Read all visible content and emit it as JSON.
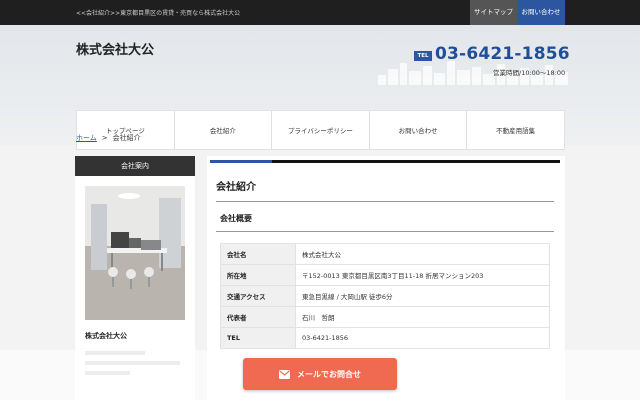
{
  "topbar": {
    "tagline": "<<会社紹介>>東京都目黒区の賃貸・売買なら株式会社大公",
    "sitemap_label": "サイトマップ",
    "contact_label": "お問い合わせ"
  },
  "header": {
    "logo": "株式会社大公",
    "tel_badge": "TEL",
    "tel": "03-6421-1856",
    "hours": "営業時間/10:00～18:00"
  },
  "nav": {
    "items": [
      {
        "label": "トップページ"
      },
      {
        "label": "会社紹介"
      },
      {
        "label": "プライバシーポリシー"
      },
      {
        "label": "お問い合わせ"
      },
      {
        "label": "不動産用語集"
      }
    ]
  },
  "breadcrumb": {
    "home": "ホーム",
    "separator": ">",
    "current": "会社紹介"
  },
  "sidebar": {
    "heading": "会社案内",
    "company_name": "株式会社大公"
  },
  "main": {
    "title": "会社紹介",
    "subtitle": "会社概要",
    "rows": [
      {
        "key": "会社名",
        "value": "株式会社大公"
      },
      {
        "key": "所在地",
        "value": "〒152-0013 東京都目黒区南3丁目11-18 折居マンション203"
      },
      {
        "key": "交通アクセス",
        "value": "東急目黒線 / 大岡山駅 徒歩6分"
      },
      {
        "key": "代表者",
        "value": "石川　哲朗"
      },
      {
        "key": "TEL",
        "value": "03-6421-1856"
      }
    ]
  },
  "cta": {
    "mail_label": "メールでお問合せ"
  },
  "colors": {
    "accent": "#2c56a0",
    "cta": "#f06a52"
  }
}
